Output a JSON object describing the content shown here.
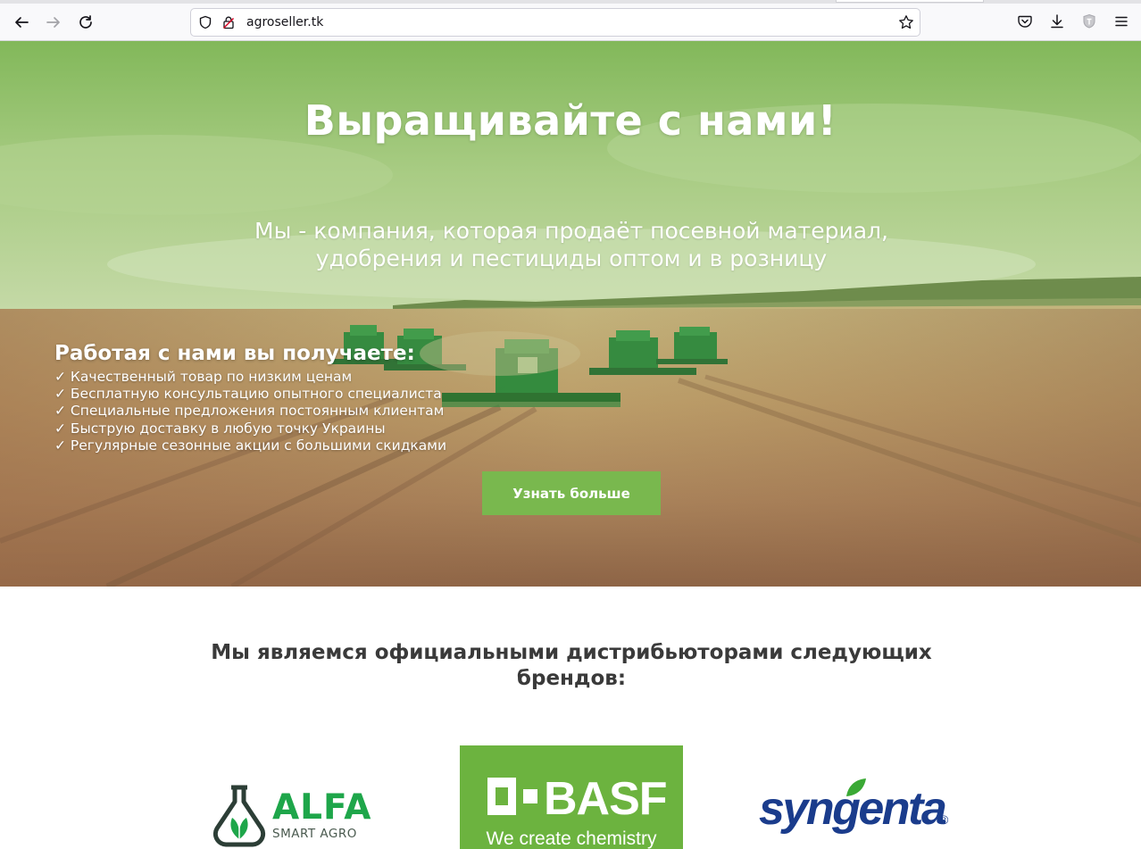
{
  "browser": {
    "url": "agroseller.tk",
    "nav_icons": [
      "back-icon",
      "forward-icon",
      "reload-icon"
    ],
    "url_icons": [
      "shield-icon",
      "lock-icon"
    ],
    "toolbar_icons": [
      "bookmark-star-icon",
      "pocket-icon",
      "download-icon",
      "extension-icon",
      "menu-icon"
    ]
  },
  "hero": {
    "title": "Выращивайте с нами!",
    "subtitle_line1": "Мы - компания, которая продаёт посевной материал,",
    "subtitle_line2": "удобрения и пестициды оптом и в розницу",
    "benefits_title": "Работая с нами вы получаете:",
    "benefits": [
      "✓ Качественный товар по низким ценам",
      "✓ Бесплатную консультацию опытного специалиста",
      "✓ Специальные предложения постоянным клиентам",
      "✓ Быструю доставку в любую точку Украины",
      "✓ Регулярные сезонные акции с большими скидками"
    ],
    "cta_label": "Узнать больше"
  },
  "brands": {
    "heading_line1": "Мы являемся официальными дистрибьюторами следующих",
    "heading_line2": "брендов:",
    "items": [
      {
        "name": "ALFA",
        "subtitle": "SMART AGRO",
        "color": "#1ea64a"
      },
      {
        "name": "BASF",
        "subtitle": "We create chemistry",
        "color": "#6cb33f"
      },
      {
        "name": "syngenta",
        "subtitle": "®",
        "color": "#1a3c8c"
      }
    ]
  },
  "colors": {
    "cta": "#79b84e",
    "heading_text": "#3a3a3a"
  }
}
